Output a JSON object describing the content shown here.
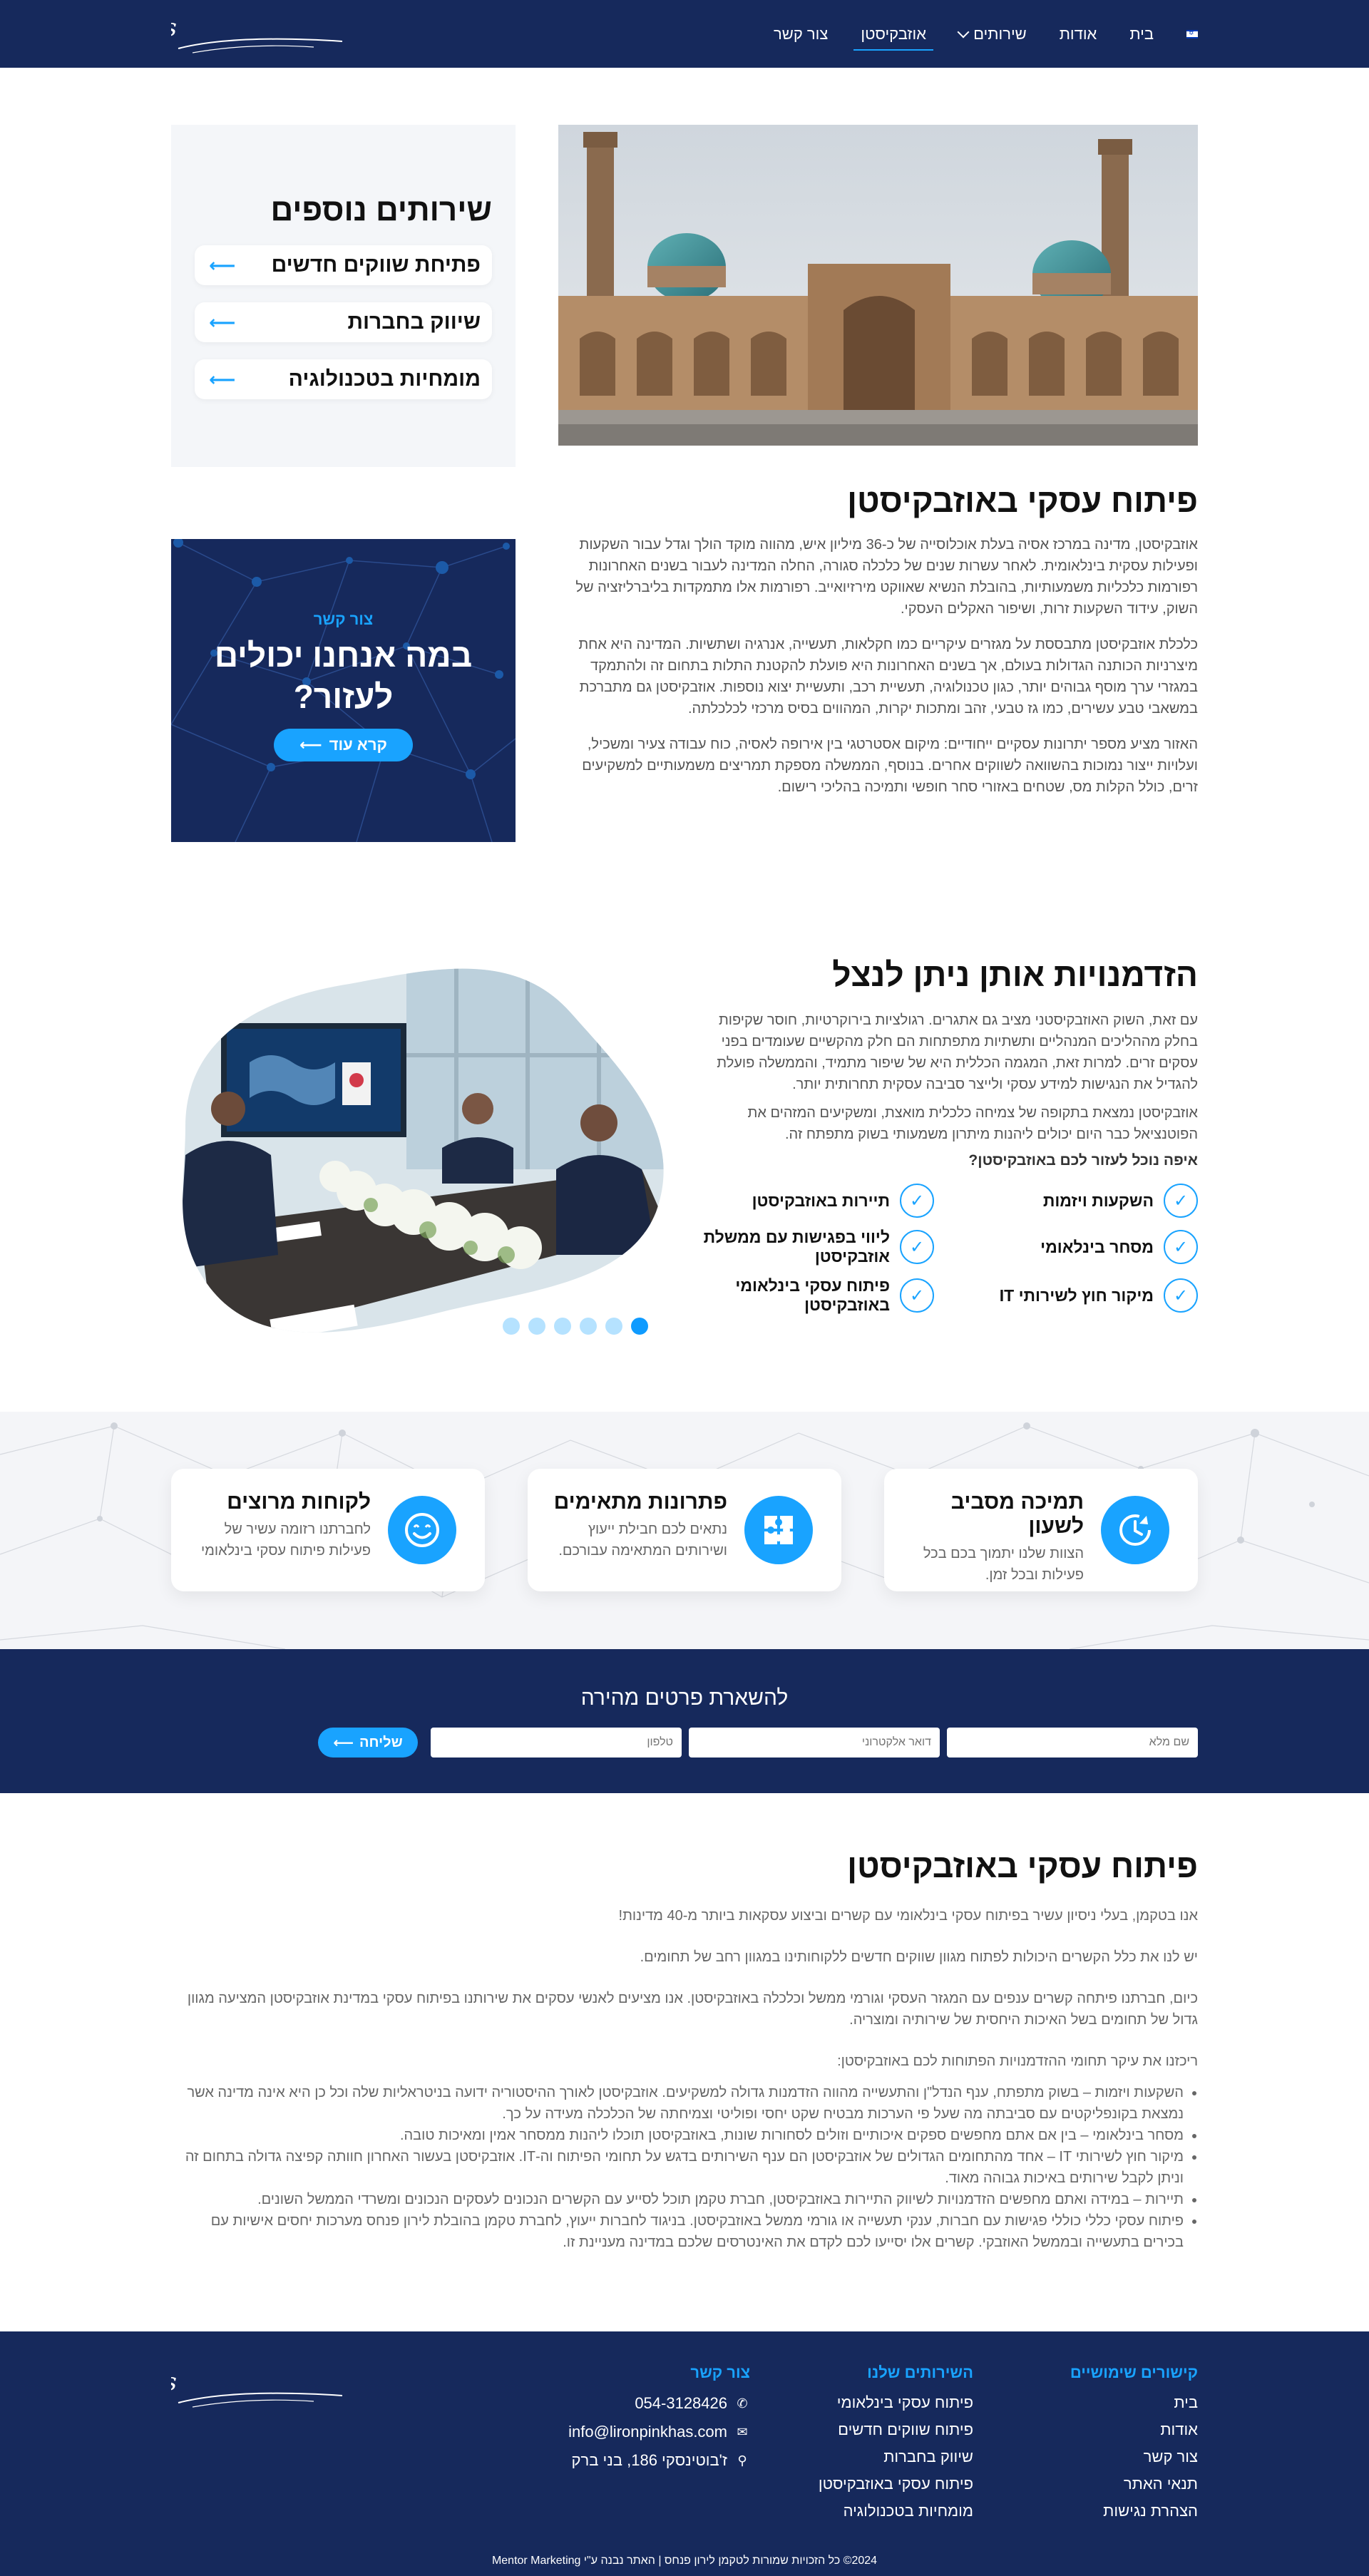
{
  "header": {
    "logo_text": "Liron Pinkhas",
    "nav": [
      {
        "label": "בית"
      },
      {
        "label": "אודות"
      },
      {
        "label": "שירותים"
      },
      {
        "label": "אוזבקיסטן"
      },
      {
        "label": "צור קשר"
      }
    ]
  },
  "sidebar": {
    "title": "שירותים נוספים",
    "links": [
      {
        "label": "פתיחת שווקים חדשים"
      },
      {
        "label": "שיווק בחברות"
      },
      {
        "label": "מומחיות בטכנולוגיה"
      }
    ]
  },
  "cta": {
    "small": "צור קשר",
    "big_line1": "במה אנחנו יכולים",
    "big_line2": "לעזור?",
    "button": "קרא עוד"
  },
  "section1": {
    "title": "פיתוח עסקי באוזבקיסטן",
    "p1": "אוזבקיסטן, מדינה במרכז אסיה בעלת אוכלוסייה של כ-36 מיליון איש, מהווה מוקד הולך וגדל עבור השקעות ופעילות עסקית בינלאומית. לאחר עשרות שנים של כלכלה סגורה, החלה המדינה לעבור בשנים האחרונות רפורמות כלכליות משמעותיות, בהובלת הנשיא שאווקט מירזיואייב. רפורמות אלו מתמקדות בליברליזציה של השוק, עידוד השקעות זרות, ושיפור האקלים העסקי.",
    "p2": "כלכלת אוזבקיסטן מתבססת על מגזרים עיקריים כמו חקלאות, תעשייה, אנרגיה ושתשיות. המדינה היא אחת מיצרניות הכותנה הגדולות בעולם, אך בשנים האחרונות היא פועלת להקטנת התלות בתחום זה ולהתמקד במגזרי ערך מוסף גבוהים יותר, כגון טכנולוגיה, תעשיית רכב, ותעשיית יצוא נוספות. אוזבקיסטן גם מתברכת במשאבי טבע עשירים, כמו גז טבעי, זהב ומתכות יקרות, המהווים בסיס מרכזי לכלכלתה.",
    "p3": "האזור מציע מספר יתרונות עסקיים ייחודיים: מיקום אסטרטגי בין אירופה לאסיה, כוח עבודה צעיר ומשכיל, ועלויות ייצור נמוכות בהשוואה לשווקים אחרים. בנוסף, הממשלה מספקת תמריצים משמעותיים למשקיעים זרים, כולל הקלות מס, שטחים באזורי סחר חופשי ותמיכה בהליכי רישום."
  },
  "section2": {
    "title": "הזדמנויות אותן ניתן לנצל",
    "p1": "עם זאת, השוק האוזבקיסטני מציב גם אתגרים. רגולציות בירוקרטיות, חוסר שקיפות בחלק מההליכים המנהליים ותשתיות מתפתחות הם חלק מהקשיים שעומדים בפני עסקים זרים. למרות זאת, המגמה הכללית היא של שיפור מתמיד, והממשלה פועלת להגדיל את הנגישות למידע עסקי ולייצר סביבה עסקית תחרותית יותר.",
    "p2": "אוזבקיסטן נמצאת בתקופה של צמיחה כלכלית מואצת, ומשקיעים המזהים את הפוטנציאל כבר היום יכולים ליהנות מיתרון משמעותי בשוק מתפתח זה.",
    "question": "איפה נוכל לעזור לכם באוזבקיסטן?",
    "checks": [
      {
        "label": "השקעות ויזמות"
      },
      {
        "label": "תיירות באוזבקיסטן"
      },
      {
        "label": "מסחר בינלאומי"
      },
      {
        "label": "ליווי בפגישות עם ממשלת אוזבקיסטן"
      },
      {
        "label": "מיקור חוץ לשירותי IT"
      },
      {
        "label": "פיתוח עסקי בינלאומי באוזבקיסטן"
      }
    ],
    "slides": 6,
    "active_slide": 1
  },
  "features": [
    {
      "title": "תמיכה מסביב לשעון",
      "text": "הצוות שלנו יתמוך בכם בכל פעילות ובכל זמן.",
      "icon": "clock-refresh-icon"
    },
    {
      "title": "פתרונות מתאימים",
      "text": "נתאים לכם חבילת ייעוץ ושירותים המתאימה עבורכם.",
      "icon": "puzzle-icon"
    },
    {
      "title": "לקוחות מרוצים",
      "text": "לחברתנו רזומה עשיר של פעילות פיתוח עסקי בינלאומי",
      "icon": "smile-icon"
    }
  ],
  "form": {
    "title": "להשארת פרטים מהירה",
    "name_placeholder": "שם מלא",
    "email_placeholder": "דואר אלקטרוני",
    "phone_placeholder": "טלפון",
    "submit": "שליחה"
  },
  "section4": {
    "title": "פיתוח עסקי באוזבקיסטן",
    "p1": "אנו בטקמן, בעלי ניסיון עשיר בפיתוח עסקי בינלאומי עם קשרים וביצוע עסקאות ביותר מ-40 מדינות!",
    "p2": "יש לנו את כלל הקשרים היכולות לפתוח מגוון שווקים חדשים ללקוחותינו במגוון רחב של תחומים.",
    "p3": "כיום, חברתנו פיתחה קשרים ענפים עם המגזר העסקי וגורמי ממשל וכלכלה באוזבקיסטן. אנו מציעים לאנשי עסקים את שירותנו בפיתוח עסקי במדינת אוזבקיסטן המציעה מגוון גדול של תחומים בשל האיכות היחסית של שירותיה ומוצריה.",
    "p4": "ריכזנו את עיקר תחומי ההזדמנויות הפתוחות לכם באוזבקיסטן:",
    "items": [
      "השקעות ויזמות – בשוק מתפתח, ענף הנדל\"ן והתעשייה מהווה הזדמנות גדולה למשקיעים. אוזבקיסטן לאורך ההיסטוריה ידועה בניטראליות שלה וכל כן היא אינה מדינה אשר נמצאת בקונפליקטים עם סביבתה מה שעל פי הערכות מבטיח שקט יחסי ופוליטי וצמיחתה של הכלכלה מעידה על כך.",
      "מסחר בינלאומי – בין אם אתם מחפשים ספקים איכותיים וזולים לסחורות שונות, באוזבקיסטן תוכלו ליהנות ממסחר אמין ומאיכות טובה.",
      "מיקור חוץ לשירותי IT – אחד מהתחומים הגדולים של אוזבקיסטן הם ענף השירותים בדגש על תחומי הפיתוח וה-IT. אוזבקיסטן בעשור האחרון חוותה קפיצה גדולה בתחום זה וניתן לקבל שירותים באיכות גבוהה מאוד.",
      "תיירות – במידה ואתם מחפשים הזדמנויות לשיווק התיירות באוזבקיסטן, חברת טקמן תוכל לסייע עם הקשרים הנכונים לעסקים הנכונים ומשרדי הממשל השונים.",
      "פיתוח עסקי כללי כוללי פגישות עם חברות, ענקי תעשייה או גורמי ממשל באוזבקיסטן. בניגוד לחברות ייעוץ, לחברת טקמן בהובלת לירון פנחס מערכות יחסים אישיות עם בכירים בתעשייה ובממשל האוזבקי. קשרים אלו יסייעו לכם לקדם את האינטרסים שלכם במדינה מעניינת זו."
    ]
  },
  "footer": {
    "logo_text": "Liron Pinkhas",
    "useful_title": "קישורים שימושיים",
    "useful_links": [
      "בית",
      "אודות",
      "צור קשר",
      "תנאי האתר",
      "הצהרת נגישות"
    ],
    "services_title": "השירותים שלנו",
    "services_links": [
      "פיתוח עסקי בינלאומי",
      "פיתוח שווקים חדשים",
      "שיווק בחברות",
      "פיתוח עסקי באוזבקיסטן",
      "מומחיות בטכנולוגיה"
    ],
    "contact_title": "צור קשר",
    "phone": "054-3128426",
    "email": "info@lironpinkhas.com",
    "address": "ז'בוטינסקי 186, בני ברק",
    "copyright": "2024© כל הזכויות שמורות לטקמן לירון פנחס | האתר נבנה ע\"י Mentor Marketing"
  },
  "colors": {
    "navy": "#16295c",
    "accent": "#19a3ff",
    "light_bg": "#f4f6f9"
  }
}
